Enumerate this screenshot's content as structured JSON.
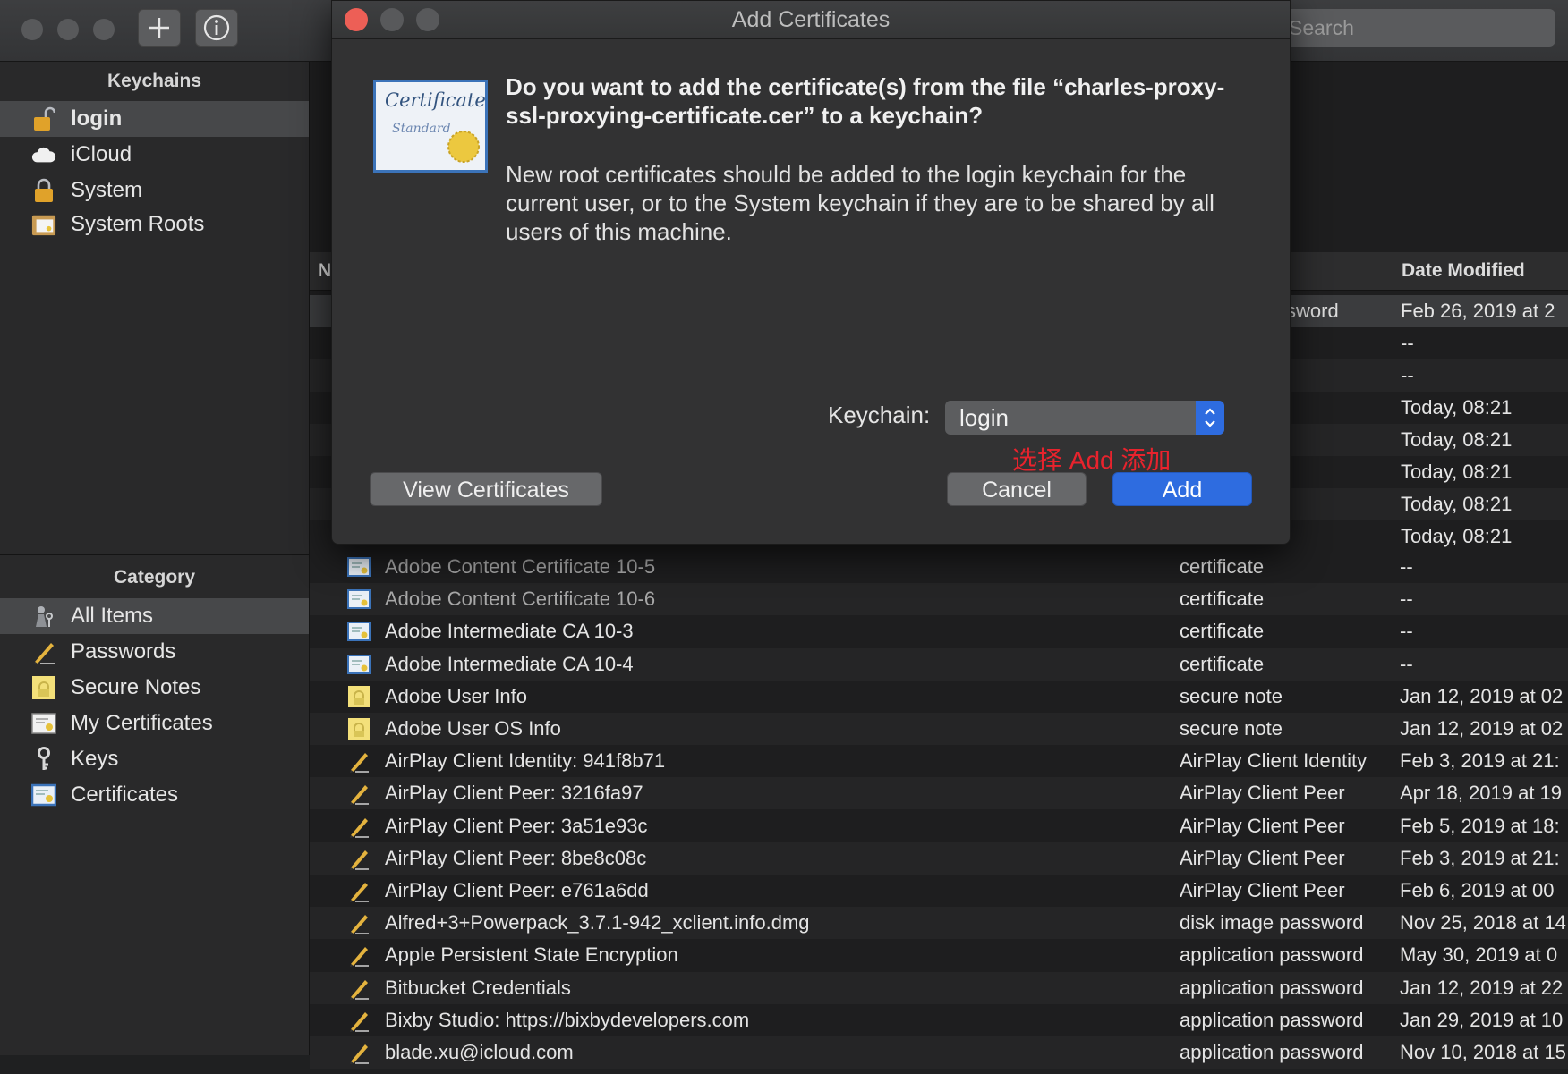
{
  "toolbar": {
    "search_placeholder": "Search"
  },
  "sidebar": {
    "keychains_title": "Keychains",
    "keychains": [
      {
        "label": "login",
        "icon": "unlocked-padlock-icon",
        "selected": true
      },
      {
        "label": "iCloud",
        "icon": "cloud-icon",
        "selected": false
      },
      {
        "label": "System",
        "icon": "padlock-icon",
        "selected": false
      },
      {
        "label": "System Roots",
        "icon": "certificate-cabinet-icon",
        "selected": false
      }
    ],
    "category_title": "Category",
    "categories": [
      {
        "label": "All Items",
        "icon": "people-keys-icon",
        "selected": true
      },
      {
        "label": "Passwords",
        "icon": "pencil-icon",
        "selected": false
      },
      {
        "label": "Secure Notes",
        "icon": "note-icon",
        "selected": false
      },
      {
        "label": "My Certificates",
        "icon": "my-certificate-icon",
        "selected": false
      },
      {
        "label": "Keys",
        "icon": "key-icon",
        "selected": false
      },
      {
        "label": "Certificates",
        "icon": "certificate-icon",
        "selected": false
      }
    ]
  },
  "table": {
    "header_name_fragment": "N",
    "header_date": "Date Modified",
    "visible_top_rows": [
      {
        "kind_fragment": "ssword",
        "date": "Feb 26, 2019 at 2"
      },
      {
        "date": "--"
      },
      {
        "date": "--"
      },
      {
        "date": "Today, 08:21"
      },
      {
        "date": "Today, 08:21"
      },
      {
        "date": "Today, 08:21"
      },
      {
        "date": "Today, 08:21"
      },
      {
        "date": "Today, 08:21"
      }
    ],
    "rows": [
      {
        "name": "Adobe Content Certificate 10-5",
        "kind": "certificate",
        "date": "--",
        "icon": "certificate-icon"
      },
      {
        "name": "Adobe Content Certificate 10-6",
        "kind": "certificate",
        "date": "--",
        "icon": "certificate-icon"
      },
      {
        "name": "Adobe Intermediate CA 10-3",
        "kind": "certificate",
        "date": "--",
        "icon": "certificate-icon"
      },
      {
        "name": "Adobe Intermediate CA 10-4",
        "kind": "certificate",
        "date": "--",
        "icon": "certificate-icon"
      },
      {
        "name": "Adobe User Info",
        "kind": "secure note",
        "date": "Jan 12, 2019 at 02",
        "icon": "note-icon"
      },
      {
        "name": "Adobe User OS Info",
        "kind": "secure note",
        "date": "Jan 12, 2019 at 02",
        "icon": "note-icon"
      },
      {
        "name": "AirPlay Client Identity: 941f8b71",
        "kind": "AirPlay Client Identity",
        "date": "Feb 3, 2019 at 21:",
        "icon": "pencil-icon"
      },
      {
        "name": "AirPlay Client Peer: 3216fa97",
        "kind": "AirPlay Client Peer",
        "date": "Apr 18, 2019 at 19",
        "icon": "pencil-icon"
      },
      {
        "name": "AirPlay Client Peer: 3a51e93c",
        "kind": "AirPlay Client Peer",
        "date": "Feb 5, 2019 at 18:",
        "icon": "pencil-icon"
      },
      {
        "name": "AirPlay Client Peer: 8be8c08c",
        "kind": "AirPlay Client Peer",
        "date": "Feb 3, 2019 at 21:",
        "icon": "pencil-icon"
      },
      {
        "name": "AirPlay Client Peer: e761a6dd",
        "kind": "AirPlay Client Peer",
        "date": "Feb 6, 2019 at 00",
        "icon": "pencil-icon"
      },
      {
        "name": "Alfred+3+Powerpack_3.7.1-942_xclient.info.dmg",
        "kind": "disk image password",
        "date": "Nov 25, 2018 at 14",
        "icon": "pencil-icon"
      },
      {
        "name": "Apple Persistent State Encryption",
        "kind": "application password",
        "date": "May 30, 2019 at 0",
        "icon": "pencil-icon"
      },
      {
        "name": "Bitbucket Credentials",
        "kind": "application password",
        "date": "Jan 12, 2019 at 22",
        "icon": "pencil-icon"
      },
      {
        "name": "Bixby Studio: https://bixbydevelopers.com",
        "kind": "application password",
        "date": "Jan 29, 2019 at 10",
        "icon": "pencil-icon"
      },
      {
        "name": "blade.xu@icloud.com",
        "kind": "application password",
        "date": "Nov 10, 2018 at 15",
        "icon": "pencil-icon"
      }
    ]
  },
  "dialog": {
    "title": "Add Certificates",
    "certificate_word": "Certificate",
    "certificate_sub": "Standard",
    "question": "Do you want to add the certificate(s) from the file “charles-proxy-ssl-proxying-certificate.cer” to a keychain?",
    "info": "New root certificates should be added to the login keychain for the current user, or to the System keychain if they are to be shared by all users of this machine.",
    "keychain_label": "Keychain:",
    "keychain_value": "login",
    "annotation": "选择 Add 添加",
    "view_certificates": "View Certificates",
    "cancel": "Cancel",
    "add": "Add"
  },
  "colors": {
    "accent_blue": "#2e6ce0",
    "annotation_red": "#e8232d",
    "close_red": "#ed5f56"
  }
}
